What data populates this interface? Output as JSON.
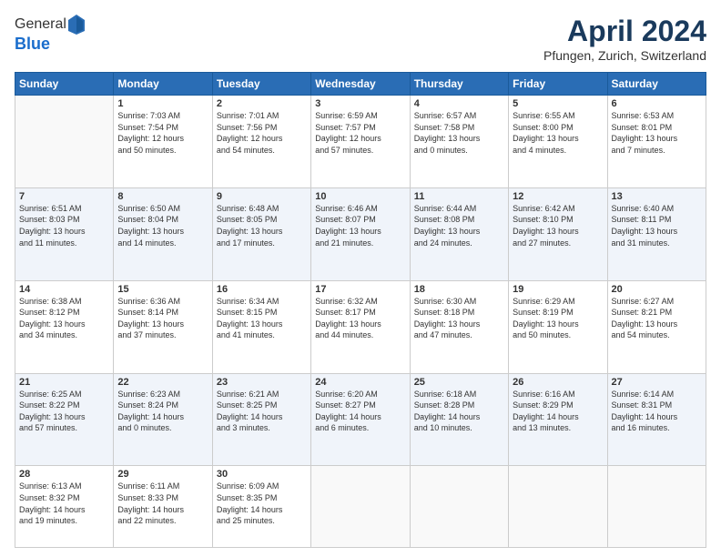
{
  "header": {
    "logo_line1": "General",
    "logo_line2": "Blue",
    "month_title": "April 2024",
    "location": "Pfungen, Zurich, Switzerland"
  },
  "days_of_week": [
    "Sunday",
    "Monday",
    "Tuesday",
    "Wednesday",
    "Thursday",
    "Friday",
    "Saturday"
  ],
  "weeks": [
    [
      {
        "day": "",
        "info": ""
      },
      {
        "day": "1",
        "info": "Sunrise: 7:03 AM\nSunset: 7:54 PM\nDaylight: 12 hours\nand 50 minutes."
      },
      {
        "day": "2",
        "info": "Sunrise: 7:01 AM\nSunset: 7:56 PM\nDaylight: 12 hours\nand 54 minutes."
      },
      {
        "day": "3",
        "info": "Sunrise: 6:59 AM\nSunset: 7:57 PM\nDaylight: 12 hours\nand 57 minutes."
      },
      {
        "day": "4",
        "info": "Sunrise: 6:57 AM\nSunset: 7:58 PM\nDaylight: 13 hours\nand 0 minutes."
      },
      {
        "day": "5",
        "info": "Sunrise: 6:55 AM\nSunset: 8:00 PM\nDaylight: 13 hours\nand 4 minutes."
      },
      {
        "day": "6",
        "info": "Sunrise: 6:53 AM\nSunset: 8:01 PM\nDaylight: 13 hours\nand 7 minutes."
      }
    ],
    [
      {
        "day": "7",
        "info": "Sunrise: 6:51 AM\nSunset: 8:03 PM\nDaylight: 13 hours\nand 11 minutes."
      },
      {
        "day": "8",
        "info": "Sunrise: 6:50 AM\nSunset: 8:04 PM\nDaylight: 13 hours\nand 14 minutes."
      },
      {
        "day": "9",
        "info": "Sunrise: 6:48 AM\nSunset: 8:05 PM\nDaylight: 13 hours\nand 17 minutes."
      },
      {
        "day": "10",
        "info": "Sunrise: 6:46 AM\nSunset: 8:07 PM\nDaylight: 13 hours\nand 21 minutes."
      },
      {
        "day": "11",
        "info": "Sunrise: 6:44 AM\nSunset: 8:08 PM\nDaylight: 13 hours\nand 24 minutes."
      },
      {
        "day": "12",
        "info": "Sunrise: 6:42 AM\nSunset: 8:10 PM\nDaylight: 13 hours\nand 27 minutes."
      },
      {
        "day": "13",
        "info": "Sunrise: 6:40 AM\nSunset: 8:11 PM\nDaylight: 13 hours\nand 31 minutes."
      }
    ],
    [
      {
        "day": "14",
        "info": "Sunrise: 6:38 AM\nSunset: 8:12 PM\nDaylight: 13 hours\nand 34 minutes."
      },
      {
        "day": "15",
        "info": "Sunrise: 6:36 AM\nSunset: 8:14 PM\nDaylight: 13 hours\nand 37 minutes."
      },
      {
        "day": "16",
        "info": "Sunrise: 6:34 AM\nSunset: 8:15 PM\nDaylight: 13 hours\nand 41 minutes."
      },
      {
        "day": "17",
        "info": "Sunrise: 6:32 AM\nSunset: 8:17 PM\nDaylight: 13 hours\nand 44 minutes."
      },
      {
        "day": "18",
        "info": "Sunrise: 6:30 AM\nSunset: 8:18 PM\nDaylight: 13 hours\nand 47 minutes."
      },
      {
        "day": "19",
        "info": "Sunrise: 6:29 AM\nSunset: 8:19 PM\nDaylight: 13 hours\nand 50 minutes."
      },
      {
        "day": "20",
        "info": "Sunrise: 6:27 AM\nSunset: 8:21 PM\nDaylight: 13 hours\nand 54 minutes."
      }
    ],
    [
      {
        "day": "21",
        "info": "Sunrise: 6:25 AM\nSunset: 8:22 PM\nDaylight: 13 hours\nand 57 minutes."
      },
      {
        "day": "22",
        "info": "Sunrise: 6:23 AM\nSunset: 8:24 PM\nDaylight: 14 hours\nand 0 minutes."
      },
      {
        "day": "23",
        "info": "Sunrise: 6:21 AM\nSunset: 8:25 PM\nDaylight: 14 hours\nand 3 minutes."
      },
      {
        "day": "24",
        "info": "Sunrise: 6:20 AM\nSunset: 8:27 PM\nDaylight: 14 hours\nand 6 minutes."
      },
      {
        "day": "25",
        "info": "Sunrise: 6:18 AM\nSunset: 8:28 PM\nDaylight: 14 hours\nand 10 minutes."
      },
      {
        "day": "26",
        "info": "Sunrise: 6:16 AM\nSunset: 8:29 PM\nDaylight: 14 hours\nand 13 minutes."
      },
      {
        "day": "27",
        "info": "Sunrise: 6:14 AM\nSunset: 8:31 PM\nDaylight: 14 hours\nand 16 minutes."
      }
    ],
    [
      {
        "day": "28",
        "info": "Sunrise: 6:13 AM\nSunset: 8:32 PM\nDaylight: 14 hours\nand 19 minutes."
      },
      {
        "day": "29",
        "info": "Sunrise: 6:11 AM\nSunset: 8:33 PM\nDaylight: 14 hours\nand 22 minutes."
      },
      {
        "day": "30",
        "info": "Sunrise: 6:09 AM\nSunset: 8:35 PM\nDaylight: 14 hours\nand 25 minutes."
      },
      {
        "day": "",
        "info": ""
      },
      {
        "day": "",
        "info": ""
      },
      {
        "day": "",
        "info": ""
      },
      {
        "day": "",
        "info": ""
      }
    ]
  ]
}
